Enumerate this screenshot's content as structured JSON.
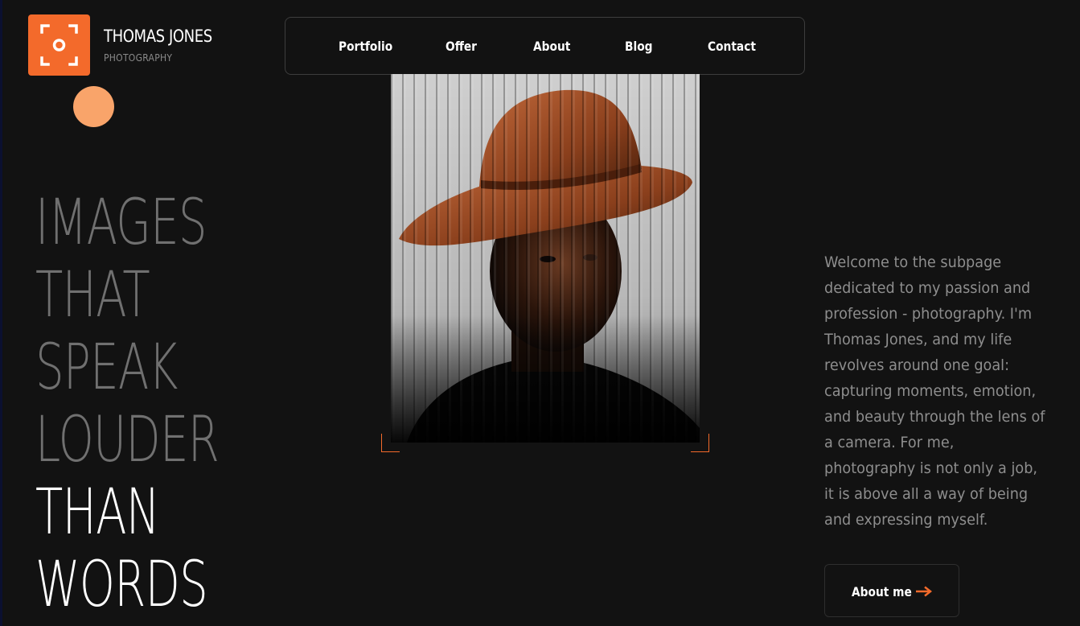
{
  "brand": {
    "name": "THOMAS JONES",
    "subtitle": "PHOTOGRAPHY",
    "logo_icon": "camera-focus-icon",
    "accent_color": "#f36a2b",
    "dot_color": "#f9a46a"
  },
  "nav": {
    "items": [
      {
        "label": "Portfolio"
      },
      {
        "label": "Offer"
      },
      {
        "label": "About"
      },
      {
        "label": "Blog"
      },
      {
        "label": "Contact"
      }
    ]
  },
  "hero": {
    "headline_lines": [
      "IMAGES",
      "THAT",
      "SPEAK",
      "LOUDER",
      "THAN",
      "WORDS"
    ],
    "intro_lines": [
      "Welcome to the subpage",
      "dedicated to my passion and",
      "profession - photography. I'm",
      "Thomas Jones, and my life",
      "revolves around one goal:",
      "capturing moments, emotion,",
      "and beauty through the lens of",
      "a camera. For me,",
      "photography is not only a job,",
      "it is above all a way of being",
      "and expressing myself."
    ],
    "cta_label": "About me",
    "cta_icon": "arrow-right-icon"
  }
}
